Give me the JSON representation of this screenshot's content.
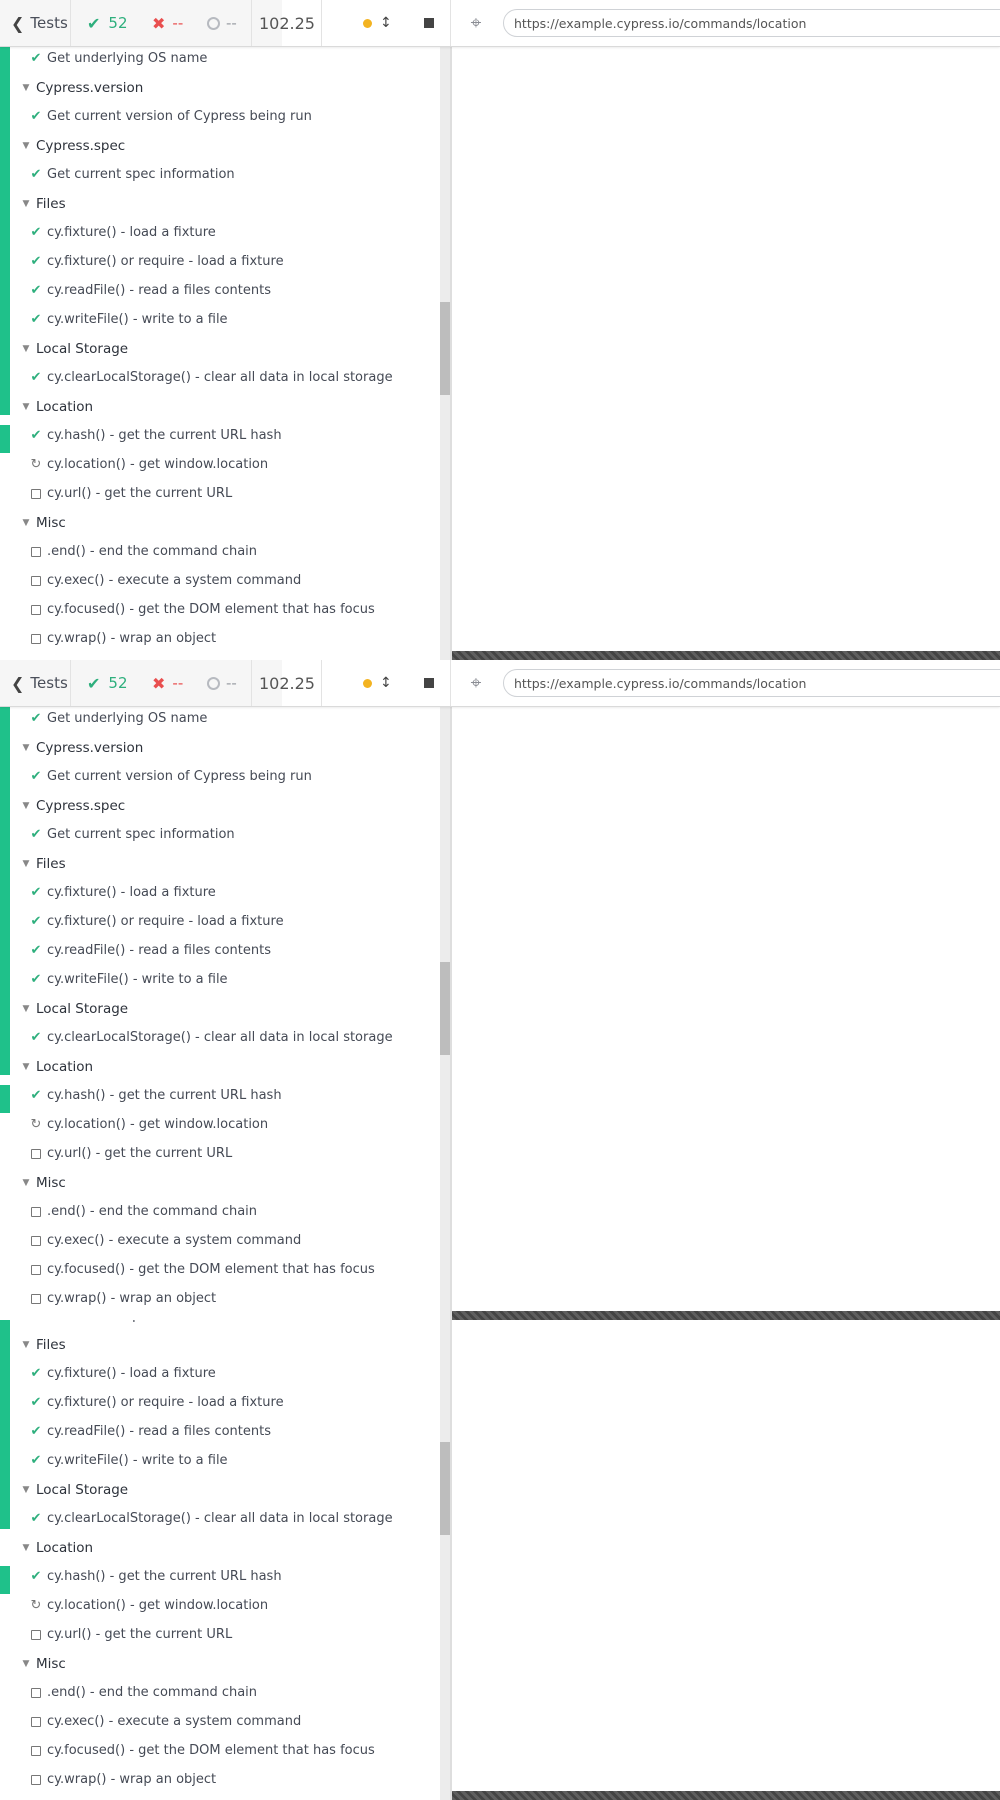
{
  "header": {
    "back_label": "Tests",
    "passed": "52",
    "failed": "--",
    "pending": "--",
    "duration": "102.25",
    "url": "https://example.cypress.io/commands/location"
  },
  "tests": {
    "os_name": "Get underlying OS name",
    "suite_version": "Cypress.version",
    "version": "Get current version of Cypress being run",
    "suite_spec": "Cypress.spec",
    "spec": "Get current spec information",
    "suite_files": "Files",
    "fixture": "cy.fixture() - load a fixture",
    "fixture_require": "cy.fixture() or require - load a fixture",
    "readfile": "cy.readFile() - read a files contents",
    "writefile": "cy.writeFile() - write to a file",
    "suite_localstorage": "Local Storage",
    "clearlocalstorage": "cy.clearLocalStorage() - clear all data in local storage",
    "suite_location": "Location",
    "hash": "cy.hash() - get the current URL hash",
    "location": "cy.location() - get window.location",
    "url": "cy.url() - get the current URL",
    "suite_misc": "Misc",
    "end": ".end() - end the command chain",
    "exec": "cy.exec() - execute a system command",
    "focused": "cy.focused() - get the DOM element that has focus",
    "wrap": "cy.wrap() - wrap an object"
  },
  "icons": {
    "back": "chevron-left-icon",
    "passed": "check-icon",
    "failed": "x-icon",
    "pending": "circle-icon",
    "running": "refresh-icon",
    "selector": "crosshair-icon"
  },
  "colors": {
    "passed": "#2eaf7d",
    "failed": "#e94f4f",
    "running_dot": "#f3b321",
    "state_bar": "#1fc18a"
  }
}
